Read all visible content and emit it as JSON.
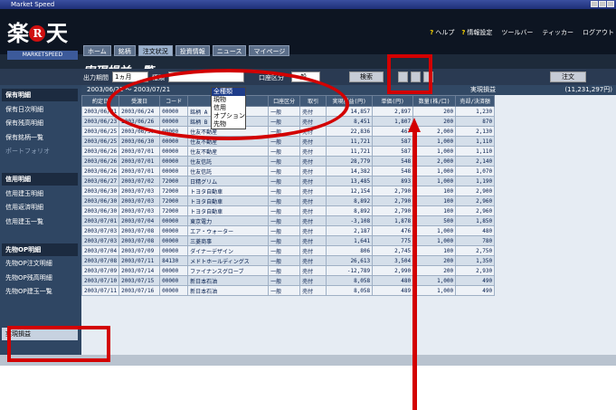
{
  "window": {
    "title": "Market Speed"
  },
  "logo": {
    "main": "楽",
    "mark": "R",
    "rest": "天",
    "sub": "MARKETSPEED"
  },
  "toplinks": [
    {
      "icon": "?",
      "label": "ヘルプ"
    },
    {
      "icon": "?",
      "label": "情報設定"
    },
    {
      "icon": "",
      "label": "ツールバー"
    },
    {
      "icon": "",
      "label": "ティッカー"
    },
    {
      "icon": "",
      "label": "ログアウト"
    }
  ],
  "nav": {
    "tabs": [
      "ホーム",
      "銘柄",
      "注文状況",
      "投資情報",
      "ニュース",
      "マイページ"
    ],
    "active": 2
  },
  "page": {
    "title": "実現損益一覧"
  },
  "toolbar": {
    "output_label": "出力期間",
    "output_value": "1ヵ月",
    "type_label": "種類",
    "type_value": "",
    "unit_label": "口座区分",
    "unit_value": "一般",
    "search_label": "検索",
    "note_label": "注文"
  },
  "dropdown": {
    "options": [
      "全種類",
      "現物",
      "信用",
      "オプション",
      "先物"
    ],
    "selected": 0
  },
  "date_range": {
    "text": "2003/06/21 ～ 2003/07/21",
    "summary_label": "実現損益",
    "summary_value": "(11,231,297円)"
  },
  "sidebar": [
    {
      "label": "保有明細",
      "style": "head"
    },
    {
      "label": "保有日次明細",
      "style": ""
    },
    {
      "label": "保有残高明細",
      "style": ""
    },
    {
      "label": "保有銘柄一覧",
      "style": ""
    },
    {
      "label": "ポートフォリオ",
      "style": "light"
    },
    {
      "label": "",
      "style": ""
    },
    {
      "label": "信用明細",
      "style": "head"
    },
    {
      "label": "信用建玉明細",
      "style": ""
    },
    {
      "label": "信用返済明細",
      "style": ""
    },
    {
      "label": "信用建玉一覧",
      "style": ""
    },
    {
      "label": "",
      "style": ""
    },
    {
      "label": "先物OP明細",
      "style": "head"
    },
    {
      "label": "先物OP注文明細",
      "style": ""
    },
    {
      "label": "先物OP残高明細",
      "style": ""
    },
    {
      "label": "先物OP建玉一覧",
      "style": ""
    },
    {
      "label": "",
      "style": ""
    },
    {
      "label": "",
      "style": ""
    },
    {
      "label": "実現損益",
      "style": "sel"
    }
  ],
  "table": {
    "headers": [
      "約定日",
      "受渡日",
      "コード",
      "銘柄名",
      "口座区分",
      "取引",
      "実現損益(円)",
      "単価(円)",
      "数量(株/口)",
      "売却/決済額"
    ],
    "rows": [
      [
        "2003/06/21",
        "2003/06/24",
        "00000",
        "銘柄 A",
        "一般",
        "売付",
        "14,857",
        "2,897",
        "200",
        "1,230"
      ],
      [
        "2003/06/23",
        "2003/06/26",
        "00000",
        "銘柄 B",
        "一般",
        "売付",
        "8,451",
        "1,807",
        "200",
        "870"
      ],
      [
        "2003/06/25",
        "2003/06/30",
        "00000",
        "住友不動産",
        "一般",
        "売付",
        "22,836",
        "467",
        "2,000",
        "2,130"
      ],
      [
        "2003/06/25",
        "2003/06/30",
        "00000",
        "住友不動産",
        "一般",
        "売付",
        "11,721",
        "587",
        "1,000",
        "1,110"
      ],
      [
        "2003/06/26",
        "2003/07/01",
        "00000",
        "住友不動産",
        "一般",
        "売付",
        "11,721",
        "587",
        "1,000",
        "1,110"
      ],
      [
        "2003/06/26",
        "2003/07/01",
        "00000",
        "住友信託",
        "一般",
        "売付",
        "28,779",
        "548",
        "2,000",
        "2,140"
      ],
      [
        "2003/06/26",
        "2003/07/01",
        "00000",
        "住友信託",
        "一般",
        "売付",
        "14,382",
        "548",
        "1,000",
        "1,070"
      ],
      [
        "2003/06/27",
        "2003/07/02",
        "72000",
        "日精グリム",
        "一般",
        "売付",
        "13,485",
        "893",
        "1,000",
        "1,190"
      ],
      [
        "2003/06/30",
        "2003/07/03",
        "72000",
        "トヨタ自動車",
        "一般",
        "売付",
        "12,154",
        "2,790",
        "100",
        "2,900"
      ],
      [
        "2003/06/30",
        "2003/07/03",
        "72000",
        "トヨタ自動車",
        "一般",
        "売付",
        "8,892",
        "2,790",
        "100",
        "2,960"
      ],
      [
        "2003/06/30",
        "2003/07/03",
        "72000",
        "トヨタ自動車",
        "一般",
        "売付",
        "8,892",
        "2,790",
        "100",
        "2,960"
      ],
      [
        "2003/07/01",
        "2003/07/04",
        "00000",
        "東京電力",
        "一般",
        "売付",
        "-3,108",
        "1,878",
        "500",
        "1,850"
      ],
      [
        "2003/07/03",
        "2003/07/08",
        "00000",
        "エア・ウォーター",
        "一般",
        "売付",
        "2,187",
        "476",
        "1,000",
        "480"
      ],
      [
        "2003/07/03",
        "2003/07/08",
        "00000",
        "三菱商事",
        "一般",
        "売付",
        "1,641",
        "775",
        "1,000",
        "780"
      ],
      [
        "2003/07/04",
        "2003/07/09",
        "00000",
        "ダイナーデザイン",
        "一般",
        "売付",
        "806",
        "2,745",
        "100",
        "2,750"
      ],
      [
        "2003/07/08",
        "2003/07/11",
        "84130",
        "メドトホールディングス",
        "一般",
        "売付",
        "26,613",
        "3,504",
        "200",
        "1,350"
      ],
      [
        "2003/07/09",
        "2003/07/14",
        "00000",
        "ファイナンスグローブ",
        "一般",
        "売付",
        "-12,789",
        "2,990",
        "200",
        "2,930"
      ],
      [
        "2003/07/10",
        "2003/07/15",
        "00000",
        "新日本石油",
        "一般",
        "売付",
        "8,058",
        "480",
        "1,000",
        "490"
      ],
      [
        "2003/07/11",
        "2003/07/16",
        "00000",
        "新日本石油",
        "一般",
        "売付",
        "8,058",
        "489",
        "1,000",
        "490"
      ]
    ]
  }
}
